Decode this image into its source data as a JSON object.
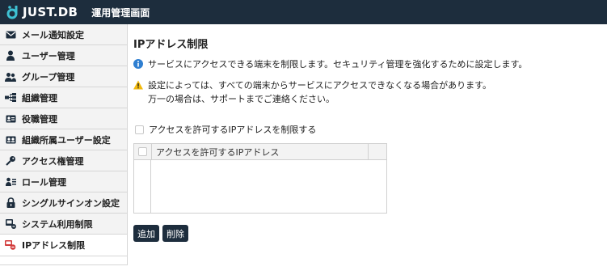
{
  "header": {
    "logo_text": "JUST.DB",
    "app_title": "運用管理画面"
  },
  "sidebar": {
    "items": [
      {
        "label": "メール通知設定",
        "icon": "mail-icon"
      },
      {
        "label": "ユーザー管理",
        "icon": "user-icon"
      },
      {
        "label": "グループ管理",
        "icon": "group-icon"
      },
      {
        "label": "組織管理",
        "icon": "org-chart-icon"
      },
      {
        "label": "役職管理",
        "icon": "id-card-icon"
      },
      {
        "label": "組織所属ユーザー設定",
        "icon": "member-card-icon"
      },
      {
        "label": "アクセス権管理",
        "icon": "key-icon"
      },
      {
        "label": "ロール管理",
        "icon": "role-icon"
      },
      {
        "label": "シングルサインオン設定",
        "icon": "lock-icon"
      },
      {
        "label": "システム利用制限",
        "icon": "system-limit-icon"
      },
      {
        "label": "IPアドレス制限",
        "icon": "ip-restrict-icon",
        "active": true
      }
    ]
  },
  "main": {
    "title": "IPアドレス制限",
    "info_text": "サービスにアクセスできる端末を制限します。セキュリティ管理を強化するために設定します。",
    "warning_lines": [
      "設定によっては、すべての端末からサービスにアクセスできなくなる場合があります。",
      "万一の場合は、サポートまでご連絡ください。"
    ],
    "restrict_checkbox_label": "アクセスを許可するIPアドレスを制限する",
    "table": {
      "header_ip": "アクセスを許可するIPアドレス",
      "rows": []
    },
    "buttons": {
      "add": "追加",
      "delete": "削除"
    }
  },
  "colors": {
    "header_bg": "#1d2d3d",
    "info_blue": "#2f7fd1",
    "warning_yellow": "#f2b90c",
    "active_icon_red": "#d23a3a"
  }
}
